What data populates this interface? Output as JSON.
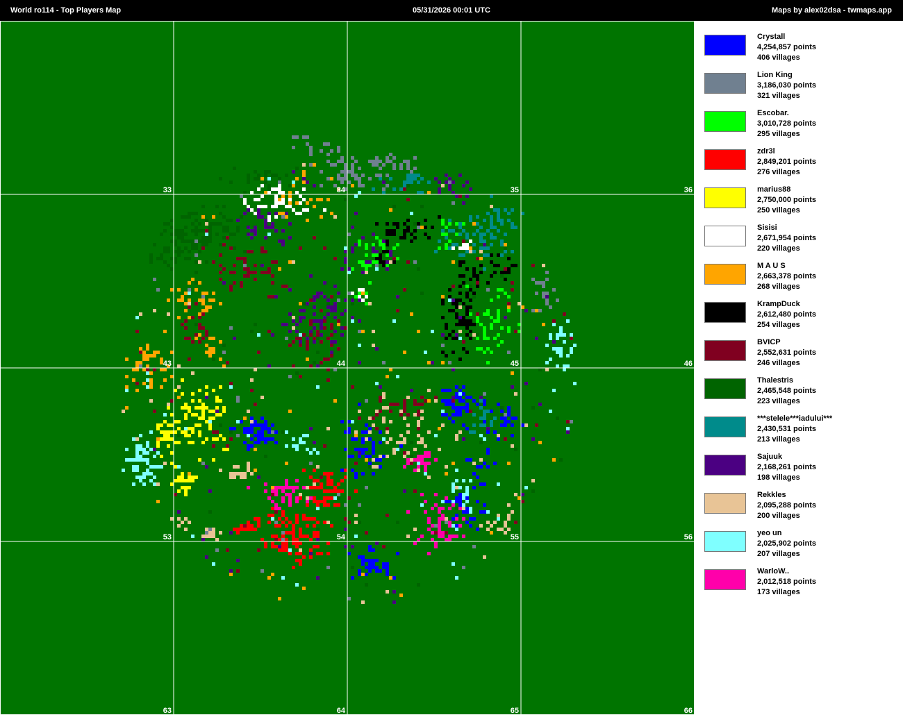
{
  "header": {
    "title_left": "World ro114  -  Top Players Map",
    "title_center": "05/31/2026 00:01 UTC",
    "title_right": "Maps by alex02dsa - twmaps.app"
  },
  "map": {
    "background": "#007400",
    "grid_color": "#ffffff",
    "sector_labels": [
      "33",
      "34",
      "35",
      "36",
      "43",
      "44",
      "45",
      "46",
      "53",
      "54",
      "55",
      "56",
      "63",
      "64",
      "65",
      "66"
    ]
  },
  "players": [
    {
      "name": "Crystall",
      "points": "4,254,857 points",
      "villages": "406 villages",
      "color": "#0000ff"
    },
    {
      "name": "Lion King",
      "points": "3,186,030 points",
      "villages": "321 villages",
      "color": "#708090"
    },
    {
      "name": "Escobar.",
      "points": "3,010,728 points",
      "villages": "295 villages",
      "color": "#00ff00"
    },
    {
      "name": "zdr3l",
      "points": "2,849,201 points",
      "villages": "276 villages",
      "color": "#ff0000"
    },
    {
      "name": "marius88",
      "points": "2,750,000 points",
      "villages": "250 villages",
      "color": "#ffff00"
    },
    {
      "name": "Sisisi",
      "points": "2,671,954 points",
      "villages": "220 villages",
      "color": "#ffffff"
    },
    {
      "name": "M A U S",
      "points": "2,663,378 points",
      "villages": "268 villages",
      "color": "#ffa500"
    },
    {
      "name": "KrampDuck",
      "points": "2,612,480 points",
      "villages": "254 villages",
      "color": "#000000"
    },
    {
      "name": "BVICP",
      "points": "2,552,631 points",
      "villages": "246 villages",
      "color": "#800020"
    },
    {
      "name": "Thalestris",
      "points": "2,465,548 points",
      "villages": "223 villages",
      "color": "#006400"
    },
    {
      "name": "***stelele***iadului***",
      "points": "2,430,531 points",
      "villages": "213 villages",
      "color": "#008b8b"
    },
    {
      "name": "Sajuuk",
      "points": "2,168,261 points",
      "villages": "198 villages",
      "color": "#4b0082"
    },
    {
      "name": "Rekkles",
      "points": "2,095,288 points",
      "villages": "200 villages",
      "color": "#e8c496"
    },
    {
      "name": "yeo un",
      "points": "2,025,902 points",
      "villages": "207 villages",
      "color": "#7fffff"
    },
    {
      "name": "WarloW..",
      "points": "2,012,518 points",
      "villages": "173 villages",
      "color": "#ff00aa"
    }
  ]
}
